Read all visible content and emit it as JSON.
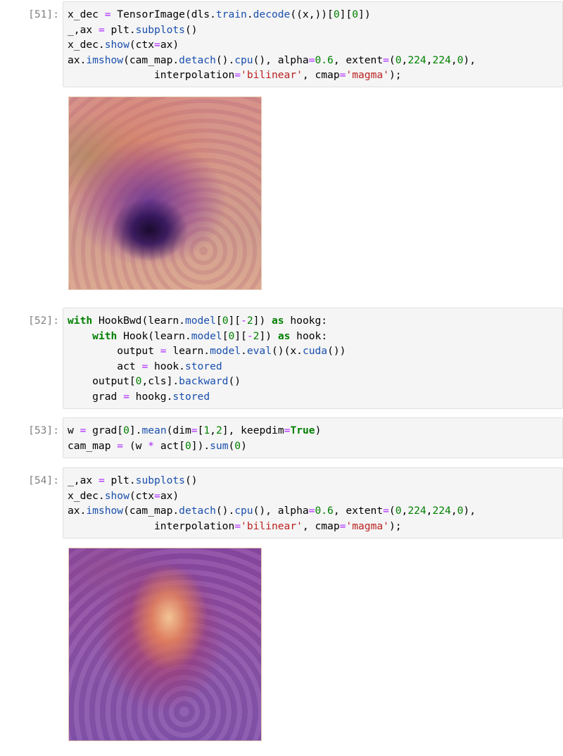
{
  "cells": [
    {
      "prompt": "[51]:",
      "lines": [
        "x_dec = TensorImage(dls.train.decode((x,))[0][0])",
        "_,ax = plt.subplots()",
        "x_dec.show(ctx=ax)",
        "ax.imshow(cam_map.detach().cpu(), alpha=0.6, extent=(0,224,224,0),",
        "              interpolation='bilinear', cmap='magma');"
      ],
      "output": "class-activation-heatmap-image"
    },
    {
      "prompt": "[52]:",
      "lines": [
        "with HookBwd(learn.model[0][-2]) as hookg:",
        "    with Hook(learn.model[0][-2]) as hook:",
        "        output = learn.model.eval()(x.cuda())",
        "        act = hook.stored",
        "    output[0,cls].backward()",
        "    grad = hookg.stored"
      ]
    },
    {
      "prompt": "[53]:",
      "lines": [
        "w = grad[0].mean(dim=[1,2], keepdim=True)",
        "cam_map = (w * act[0]).sum(0)"
      ]
    },
    {
      "prompt": "[54]:",
      "lines": [
        "_,ax = plt.subplots()",
        "x_dec.show(ctx=ax)",
        "ax.imshow(cam_map.detach().cpu(), alpha=0.6, extent=(0,224,224,0),",
        "              interpolation='bilinear', cmap='magma');"
      ],
      "output": "gradcam-heatmap-image"
    }
  ],
  "colors": {
    "keyword": "#008000",
    "attribute": "#1a4fad",
    "operator": "#aa22ff",
    "number": "#008000",
    "string": "#ba2121",
    "prompt": "#7f7f7f",
    "cell_background": "#f5f5f5"
  }
}
